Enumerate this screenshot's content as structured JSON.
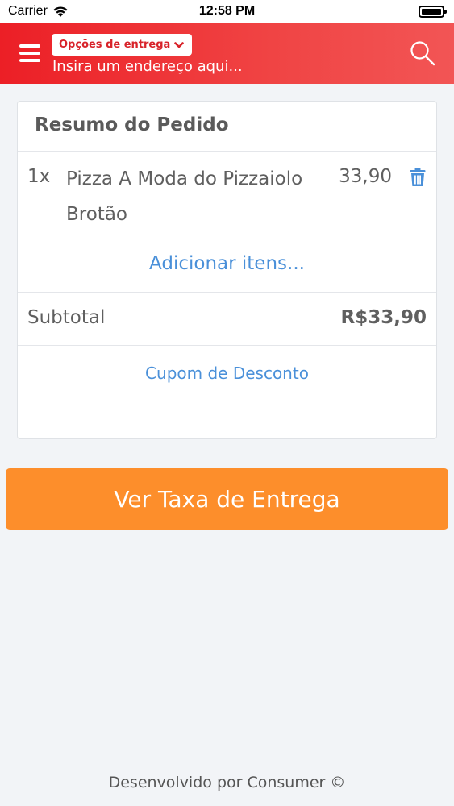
{
  "status_bar": {
    "carrier": "Carrier",
    "time": "12:58 PM",
    "battery_level": 1.0
  },
  "header": {
    "delivery_options_label": "Opções de entrega",
    "address_placeholder": "Insira um endereço aqui...",
    "brand_color": "#ec1f26"
  },
  "order_summary": {
    "title": "Resumo do Pedido",
    "items": [
      {
        "quantity": "1x",
        "name": "Pizza A Moda do Pizzaiolo Brotão",
        "price": "33,90"
      }
    ],
    "add_items_label": "Adicionar itens...",
    "subtotal_label": "Subtotal",
    "subtotal_value": "R$33,90",
    "coupon_label": "Cupom de Desconto"
  },
  "cta": {
    "label": "Ver Taxa de Entrega",
    "color": "#fd8e2b"
  },
  "footer": {
    "text": "Desenvolvido por Consumer ©"
  },
  "icons": [
    "wifi-icon",
    "battery-icon",
    "hamburger-menu-icon",
    "chevron-down-icon",
    "search-icon",
    "trash-icon"
  ]
}
